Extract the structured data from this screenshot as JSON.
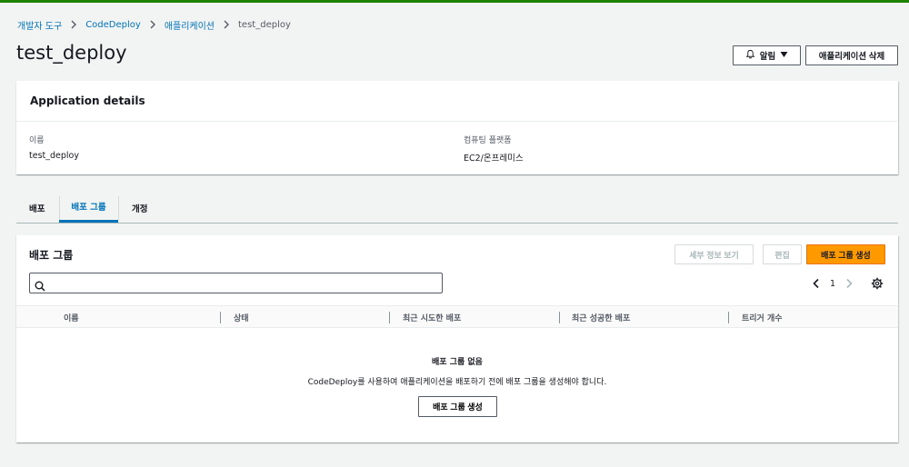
{
  "breadcrumb": {
    "items": [
      "개발자 도구",
      "CodeDeploy",
      "애플리케이션"
    ],
    "current": "test_deploy"
  },
  "page": {
    "title": "test_deploy",
    "notify_label": "알림",
    "delete_label": "애플리케이션 삭제"
  },
  "details": {
    "title": "Application details",
    "name_label": "이름",
    "name_value": "test_deploy",
    "platform_label": "컴퓨팅 플랫폼",
    "platform_value": "EC2/온프레미스"
  },
  "tabs": [
    {
      "label": "배포",
      "active": false
    },
    {
      "label": "배포 그룹",
      "active": true
    },
    {
      "label": "개정",
      "active": false
    }
  ],
  "groups": {
    "title": "배포 그룹",
    "view_details_label": "세부 정보 보기",
    "edit_label": "편집",
    "create_label": "배포 그룹 생성",
    "search_placeholder": "",
    "page_number": "1",
    "columns": [
      "이름",
      "상태",
      "최근 시도한 배포",
      "최근 성공한 배포",
      "트리거 개수"
    ],
    "empty_title": "배포 그룹 없음",
    "empty_desc": "CodeDeploy를 사용하여 애플리케이션을 배포하기 전에 배포 그룹을 생성해야 합니다.",
    "empty_create_label": "배포 그룹 생성"
  },
  "colors": {
    "accent": "#0073bb",
    "primary_button": "#ff9900",
    "top_bar": "#1d8102"
  }
}
